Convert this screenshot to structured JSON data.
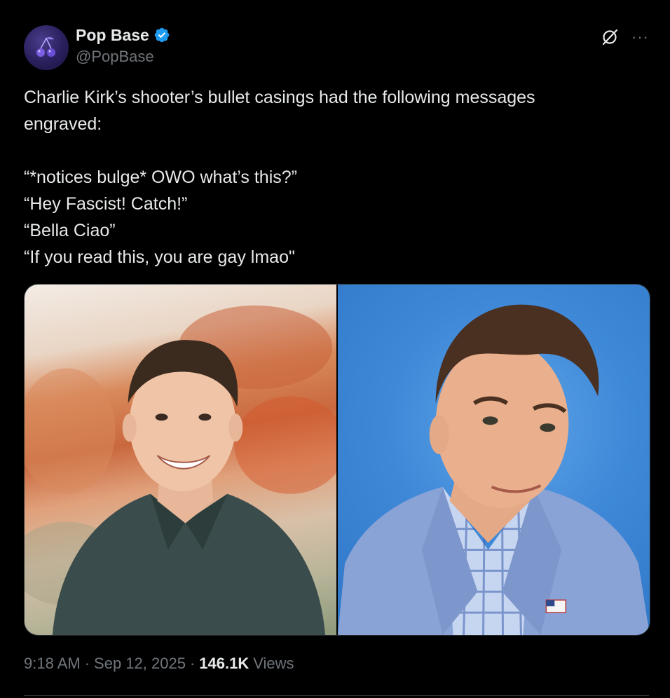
{
  "author": {
    "display_name": "Pop Base",
    "handle": "@PopBase",
    "verified": true,
    "avatar_icon": "cherry-icon"
  },
  "actions": {
    "grok_icon": "grok-icon",
    "more_label": "···"
  },
  "tweet": {
    "lines": [
      "Charlie Kirk’s shooter’s bullet casings had the following messages",
      "engraved:",
      "",
      "“*notices bulge* OWO what’s this?”",
      "“Hey Fascist! Catch!”",
      "“Bella Ciao”",
      "“If you read this, you are gay lmao\""
    ]
  },
  "meta": {
    "time": "9:18 AM",
    "separator": "·",
    "date": "Sep 12, 2025",
    "views_count": "146.1K",
    "views_label": "Views"
  },
  "colors": {
    "background": "#000000",
    "text": "#e7e9ea",
    "muted": "#71767b",
    "verified": "#1d9bf0"
  }
}
